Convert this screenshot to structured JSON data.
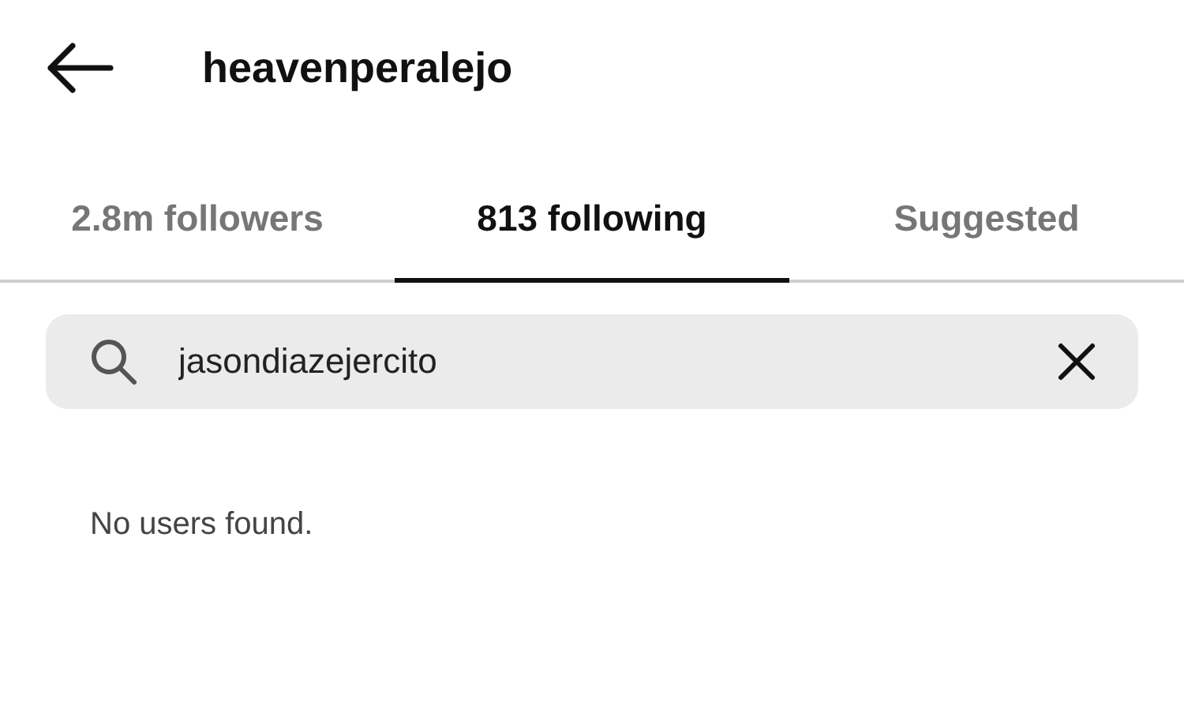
{
  "header": {
    "title": "heavenperalejo"
  },
  "tabs": [
    {
      "label": "2.8m followers",
      "selected": false
    },
    {
      "label": "813 following",
      "selected": true
    },
    {
      "label": "Suggested",
      "selected": false
    }
  ],
  "search": {
    "value": "jasondiazejercito"
  },
  "message": "No users found."
}
